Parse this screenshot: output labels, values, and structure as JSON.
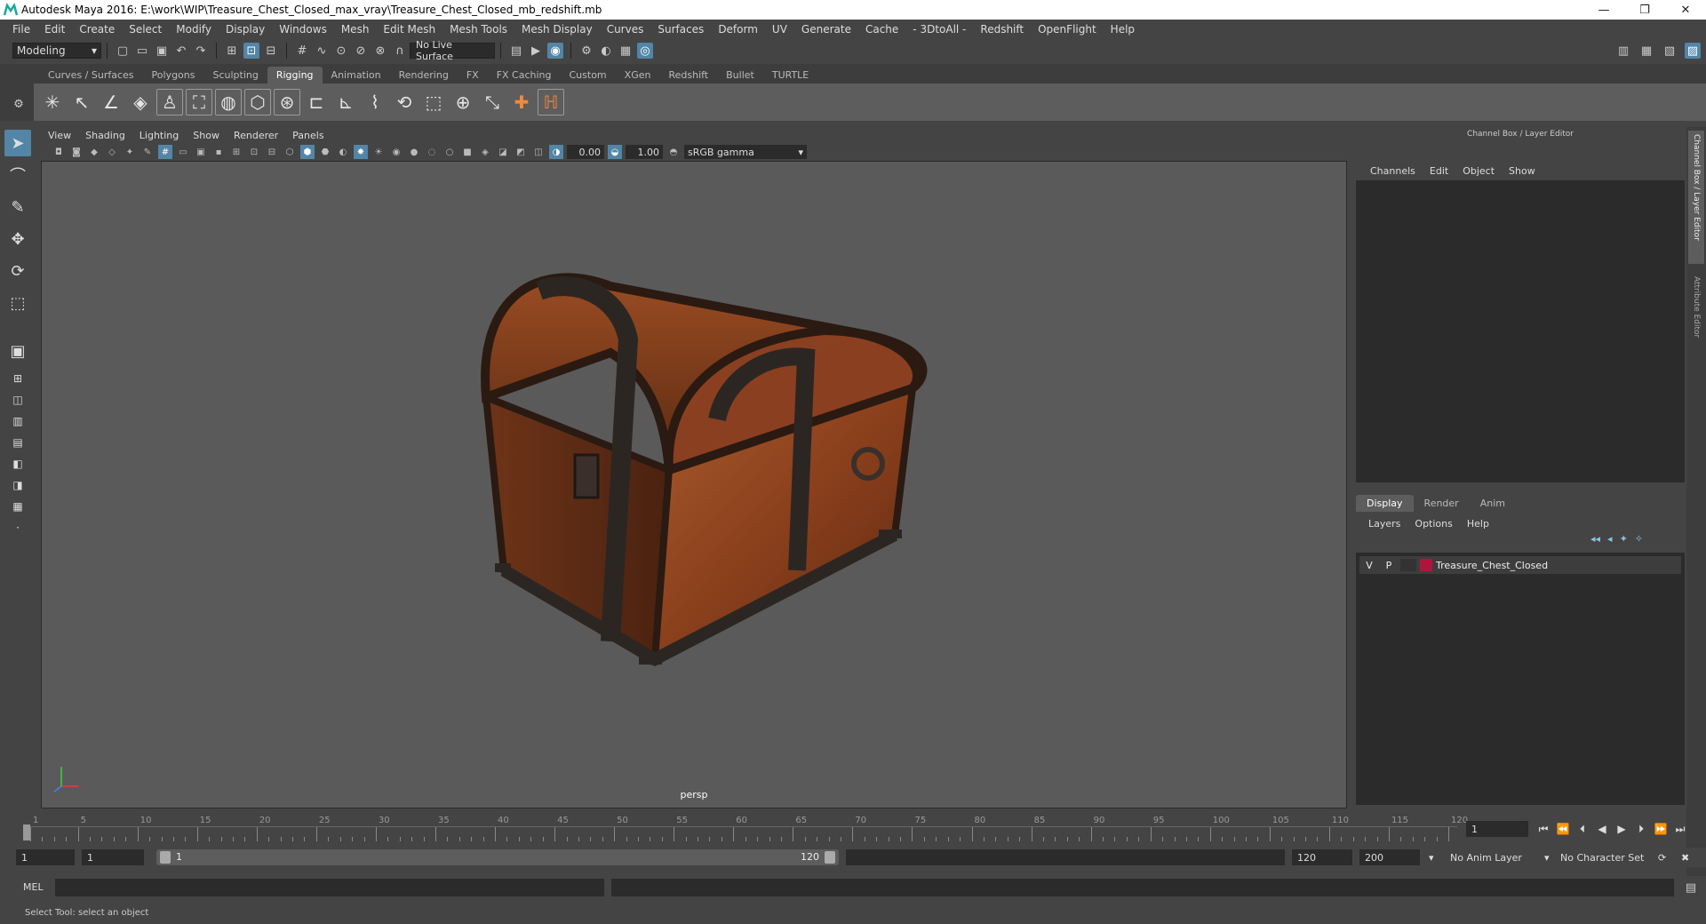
{
  "window": {
    "title": "Autodesk Maya 2016: E:\\work\\WIP\\Treasure_Chest_Closed_max_vray\\Treasure_Chest_Closed_mb_redshift.mb",
    "controls": [
      "—",
      "❐",
      "✕"
    ]
  },
  "menubar": [
    "File",
    "Edit",
    "Create",
    "Select",
    "Modify",
    "Display",
    "Windows",
    "Mesh",
    "Edit Mesh",
    "Mesh Tools",
    "Mesh Display",
    "Curves",
    "Surfaces",
    "Deform",
    "UV",
    "Generate",
    "Cache",
    "- 3DtoAll -",
    "Redshift",
    "OpenFlight",
    "Help"
  ],
  "statusline": {
    "mode": "Modeling",
    "live_surface": "No Live Surface"
  },
  "shelf": {
    "tabs": [
      "Curves / Surfaces",
      "Polygons",
      "Sculpting",
      "Rigging",
      "Animation",
      "Rendering",
      "FX",
      "FX Caching",
      "Custom",
      "XGen",
      "Redshift",
      "Bullet",
      "TURTLE"
    ],
    "active_tab": "Rigging"
  },
  "viewport": {
    "menu": [
      "View",
      "Shading",
      "Lighting",
      "Show",
      "Renderer",
      "Panels"
    ],
    "exposure": "0.00",
    "gamma": "1.00",
    "color_space": "sRGB gamma",
    "camera": "persp"
  },
  "channel_box": {
    "title": "Channel Box / Layer Editor",
    "menu": [
      "Channels",
      "Edit",
      "Object",
      "Show"
    ]
  },
  "side_tabs": [
    "Channel Box / Layer Editor",
    "Attribute Editor"
  ],
  "layer_editor": {
    "tabs": [
      "Display",
      "Render",
      "Anim"
    ],
    "active_tab": "Display",
    "menu": [
      "Layers",
      "Options",
      "Help"
    ],
    "layers": [
      {
        "v": "V",
        "p": "P",
        "name": "Treasure_Chest_Closed",
        "color": "#b0143c"
      }
    ]
  },
  "timeline": {
    "ticks": [
      "1",
      "5",
      "10",
      "15",
      "20",
      "25",
      "30",
      "35",
      "40",
      "45",
      "50",
      "55",
      "60",
      "65",
      "70",
      "75",
      "80",
      "85",
      "90",
      "95",
      "100",
      "105",
      "110",
      "115",
      "120"
    ],
    "current_frame": "1"
  },
  "range": {
    "start": "1",
    "playback_start": "1",
    "range_start_label": "1",
    "range_end_label": "120",
    "playback_end": "120",
    "end": "200",
    "anim_layer": "No Anim Layer",
    "character_set": "No Character Set"
  },
  "command_line": {
    "label": "MEL"
  },
  "help_line": "Select Tool: select an object"
}
